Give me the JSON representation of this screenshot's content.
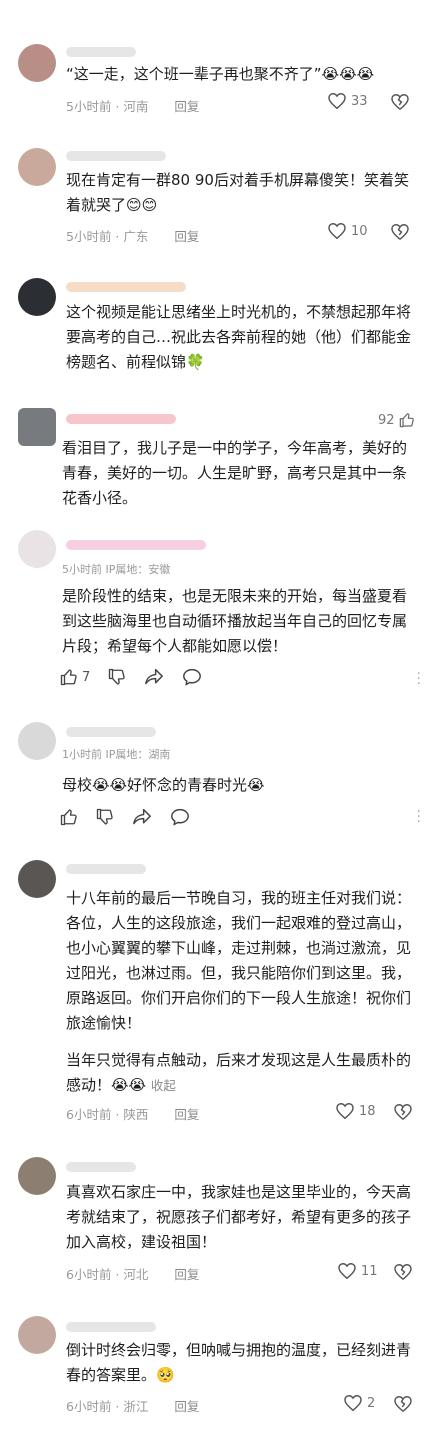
{
  "comments": [
    {
      "text": "“这一走，这个班一辈子再也聚不齐了”😭😭😭",
      "time": "5小时前",
      "location": "河南",
      "reply": "回复",
      "likes": "33"
    },
    {
      "text": "现在肯定有一群80 90后对着手机屏幕傻笑！笑着笑着就哭了😊😊",
      "time": "5小时前",
      "location": "广东",
      "reply": "回复",
      "likes": "10"
    },
    {
      "text": "这个视频是能让思绪坐上时光机的，不禁想起那年将要高考的自己…祝此去各奔前程的她（他）们都能金榜题名、前程似锦🍀"
    },
    {
      "text": "看泪目了，我儿子是一中的学子，今年高考，美好的青春，美好的一切。人生是旷野，高考只是其中一条花香小径。",
      "likes": "92"
    },
    {
      "sub": "5小时前 IP属地：安徽",
      "text": "是阶段性的结束，也是无限未来的开始，每当盛夏看到这些脑海里也自动循环播放起当年自己的回忆专属片段；希望每个人都能如愿以偿！",
      "likes": "7"
    },
    {
      "sub": "1小时前 IP属地：湖南",
      "text": "母校😭😭好怀念的青春时光😭"
    },
    {
      "text": "十八年前的最后一节晚自习，我的班主任对我们说：各位，人生的这段旅途，我们一起艰难的登过高山，也小心翼翼的攀下山峰，走过荆棘，也淌过激流，见过阳光，也淋过雨。但，我只能陪你们到这里。我，原路返回。你们开启你们的下一段人生旅途！祝你们旅途愉快！",
      "text2": "当年只觉得有点触动，后来才发现这是人生最质朴的感动！😭😭",
      "collapse": "收起",
      "time": "6小时前",
      "location": "陕西",
      "reply": "回复",
      "likes": "18"
    },
    {
      "text": "真喜欢石家庄一中，我家娃也是这里毕业的，今天高考就结束了，祝愿孩子们都考好，希望有更多的孩子加入高校，建设祖国！",
      "time": "6小时前",
      "location": "河北",
      "reply": "回复",
      "likes": "11"
    },
    {
      "text": "倒计时终会归零，但呐喊与拥抱的温度，已经刻进青春的答案里。🥺",
      "time": "6小时前",
      "location": "浙江",
      "reply": "回复",
      "likes": "2"
    }
  ]
}
